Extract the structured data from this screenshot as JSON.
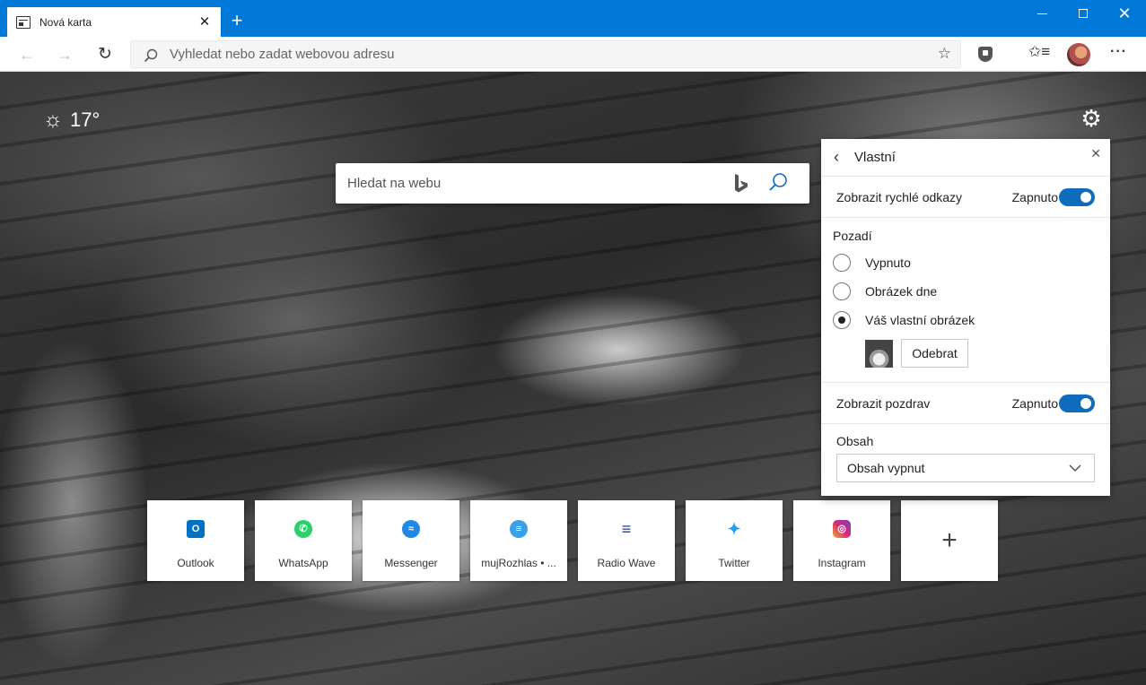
{
  "browser": {
    "tab_title": "Nová karta",
    "tab_close": "✕",
    "new_tab": "+",
    "window_close": "✕",
    "address_placeholder": "Vyhledat nebo zadat webovou adresu",
    "icons": [
      "back-arrow-icon",
      "forward-arrow-icon",
      "refresh-icon",
      "search-icon",
      "star-icon",
      "shield-icon",
      "favorites-icon",
      "avatar",
      "more-icon"
    ]
  },
  "weather": {
    "icon": "sun-icon",
    "temperature": "17°"
  },
  "search": {
    "placeholder": "Hledat na webu"
  },
  "quick_links": [
    {
      "label": "Outlook",
      "icon": "outlook-icon",
      "color": "#0072c6",
      "glyph": "O"
    },
    {
      "label": "WhatsApp",
      "icon": "whatsapp-icon",
      "color": "#25d366",
      "glyph": "✆"
    },
    {
      "label": "Messenger",
      "icon": "messenger-icon",
      "color": "#1e88e5",
      "glyph": "≈"
    },
    {
      "label": "mujRozhlas • ...",
      "icon": "mujrozhlas-icon",
      "color": "#3aa0e8",
      "glyph": "≡"
    },
    {
      "label": "Radio Wave",
      "icon": "radio-wave-icon",
      "color": "#1d3f8f",
      "glyph": "≡"
    },
    {
      "label": "Twitter",
      "icon": "twitter-icon",
      "color": "#1da1f2",
      "glyph": "✦"
    },
    {
      "label": "Instagram",
      "icon": "instagram-icon",
      "color": "#d6287a",
      "glyph": "◎"
    }
  ],
  "add_tile": "+",
  "panel": {
    "title": "Vlastní",
    "back": "‹",
    "close": "✕",
    "quick_links_label": "Zobrazit rychlé odkazy",
    "quick_links_state": "Zapnuto",
    "quick_links_on": true,
    "background_title": "Pozadí",
    "background_options": [
      {
        "label": "Vypnuto",
        "checked": false
      },
      {
        "label": "Obrázek dne",
        "checked": false
      },
      {
        "label": "Váš vlastní obrázek",
        "checked": true
      }
    ],
    "remove_button": "Odebrat",
    "greeting_label": "Zobrazit pozdrav",
    "greeting_state": "Zapnuto",
    "greeting_on": true,
    "content_label": "Obsah",
    "content_value": "Obsah vypnut"
  },
  "colors": {
    "titlebar": "#0078d7",
    "toggle_on": "#0f6cbd"
  }
}
